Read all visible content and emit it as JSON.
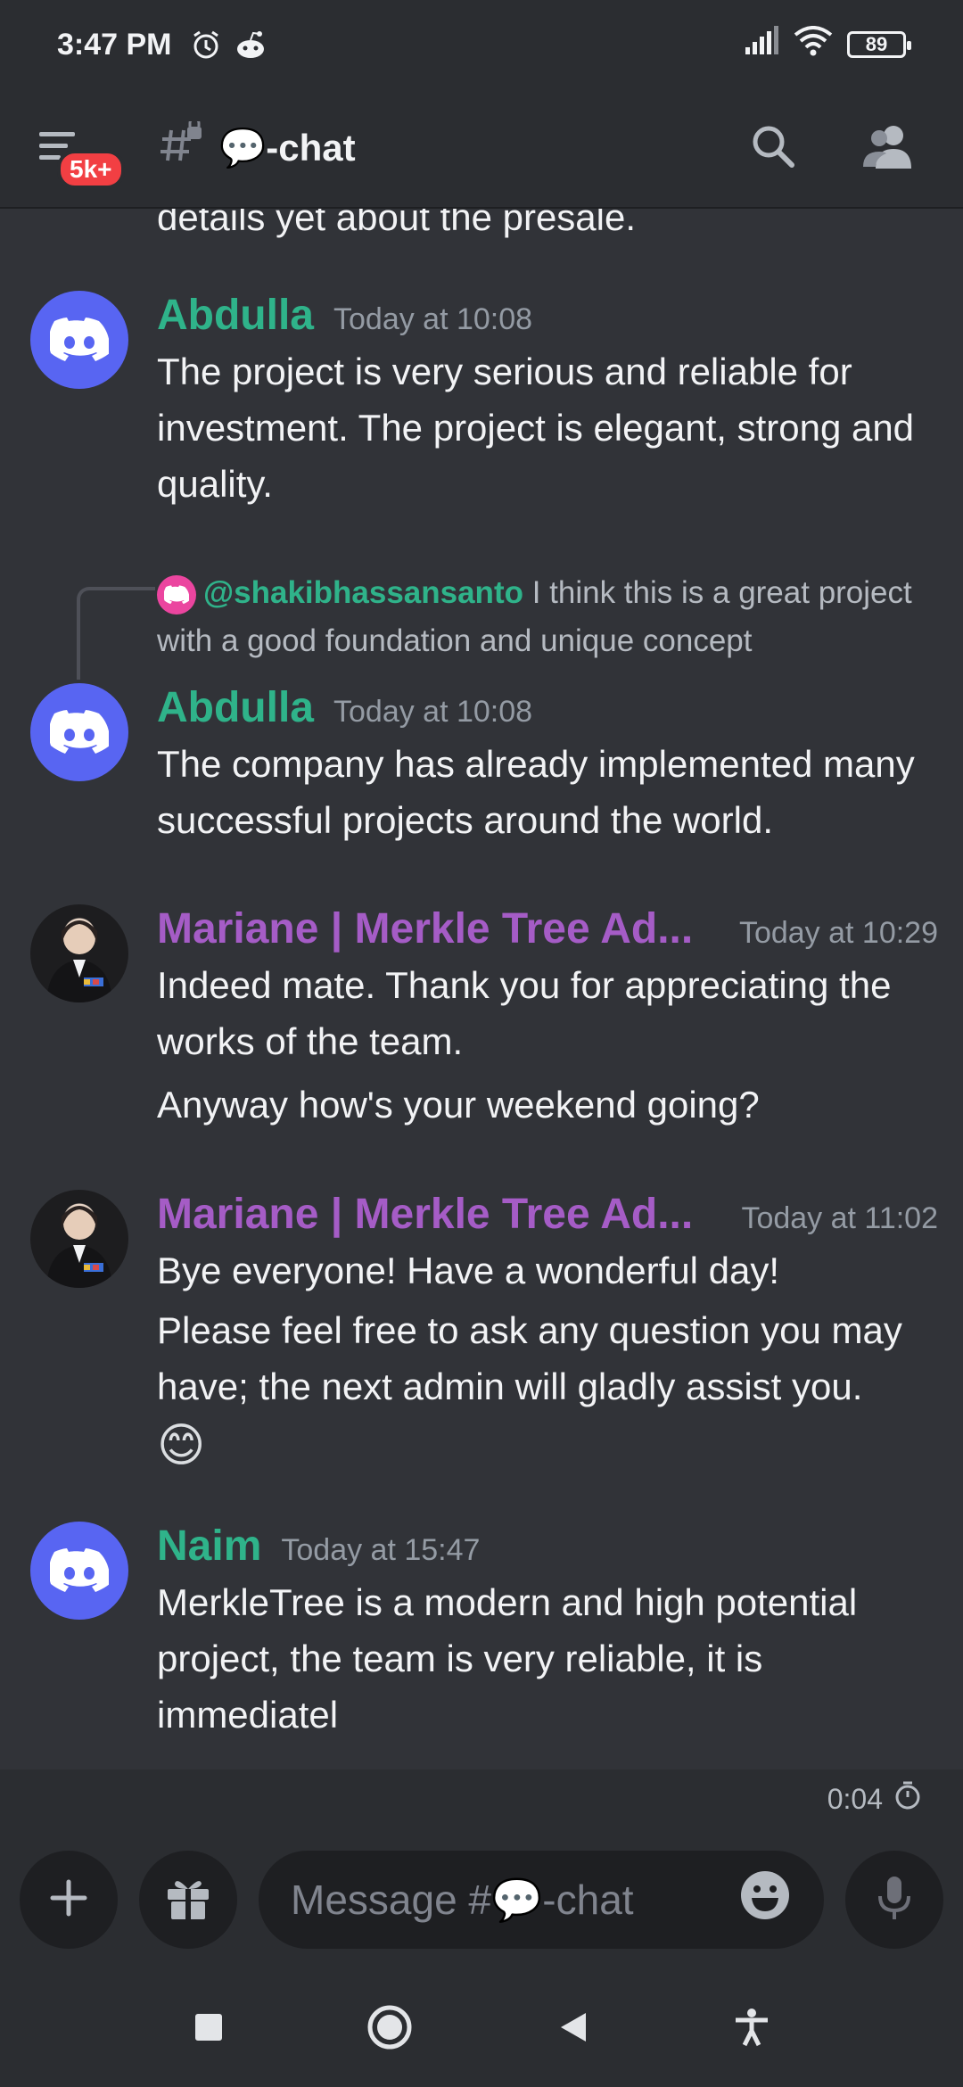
{
  "status_bar": {
    "time": "3:47 PM",
    "battery": "89",
    "icons": [
      "alarm-icon",
      "reddit-icon",
      "signal-icon",
      "wifi-icon",
      "battery-icon"
    ]
  },
  "header": {
    "badge": "5k+",
    "channel_name": "💬-chat",
    "icons": [
      "menu-icon",
      "locked-channel-icon",
      "search-icon",
      "members-icon"
    ]
  },
  "messages": {
    "truncated_top_text": "details yet about the presale.",
    "m1": {
      "author": "Abdulla",
      "time": "Today at 10:08",
      "text": "The project is very serious and reliable for investment. The project is elegant, strong and quality."
    },
    "m2": {
      "reply_mention": "@shakibhassansanto",
      "reply_text": " I think this is a great project with a good foundation and unique concept",
      "author": "Abdulla",
      "time": "Today at 10:08",
      "text": "The company has already implemented many successful projects around the world."
    },
    "m3": {
      "author": "Mariane | Merkle Tree Ad...",
      "time": "Today at 10:29",
      "text": "Indeed mate.  Thank you for appreciating the works of the team.",
      "text2": "Anyway how's your weekend going?"
    },
    "m4": {
      "author": "Mariane | Merkle Tree Ad...",
      "time": "Today at 11:02",
      "text1": "Bye everyone! Have a wonderful day!",
      "text2": "Please feel free to ask any question you may have; the next admin will gladly assist you.",
      "emoji": "😊"
    },
    "m5": {
      "author": "Naim",
      "time": "Today at 15:47",
      "text": "MerkleTree  is a modern and high potential project, the team is very reliable, it is immediatel"
    }
  },
  "timer": {
    "value": "0:04"
  },
  "composer": {
    "placeholder": "Message #💬-chat"
  },
  "colors": {
    "background": "#313338",
    "author_green": "#2fb38a",
    "author_purple": "#a55cc6",
    "discord_blurple": "#5865f2",
    "badge_red": "#f23f43"
  }
}
